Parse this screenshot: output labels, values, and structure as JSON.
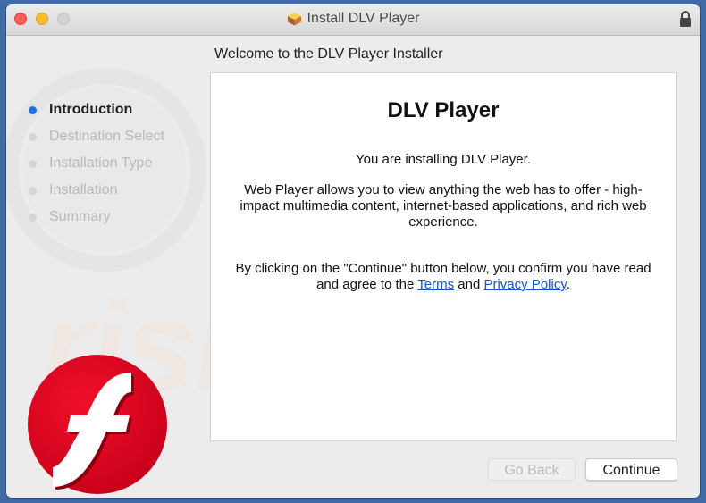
{
  "window": {
    "title": "Install DLV Player",
    "title_icon": "package-icon",
    "lock_icon": "lock-icon",
    "traffic_lights": [
      "close",
      "minimize",
      "zoom"
    ]
  },
  "header": {
    "subtitle": "Welcome to the DLV Player Installer"
  },
  "sidebar": {
    "steps": [
      {
        "label": "Introduction",
        "active": true
      },
      {
        "label": "Destination Select",
        "active": false
      },
      {
        "label": "Installation Type",
        "active": false
      },
      {
        "label": "Installation",
        "active": false
      },
      {
        "label": "Summary",
        "active": false
      }
    ],
    "logo_icon": "flash-player-logo-icon"
  },
  "content": {
    "heading": "DLV Player",
    "line1": "You are installing DLV Player.",
    "description": "Web Player allows you to view anything the web has to offer - high-impact multimedia content, internet-based applications, and rich web experience.",
    "agreement_prefix": "By clicking on the \"Continue\" button below, you confirm you have read and agree to the ",
    "terms_link": "Terms",
    "and_text": " and ",
    "privacy_link": "Privacy Policy",
    "agreement_suffix": ".",
    "link_color": "#1155cc"
  },
  "buttons": {
    "back": "Go Back",
    "continue": "Continue"
  },
  "colors": {
    "active_step": "#1a73e8",
    "desktop": "#3f6aa6"
  }
}
